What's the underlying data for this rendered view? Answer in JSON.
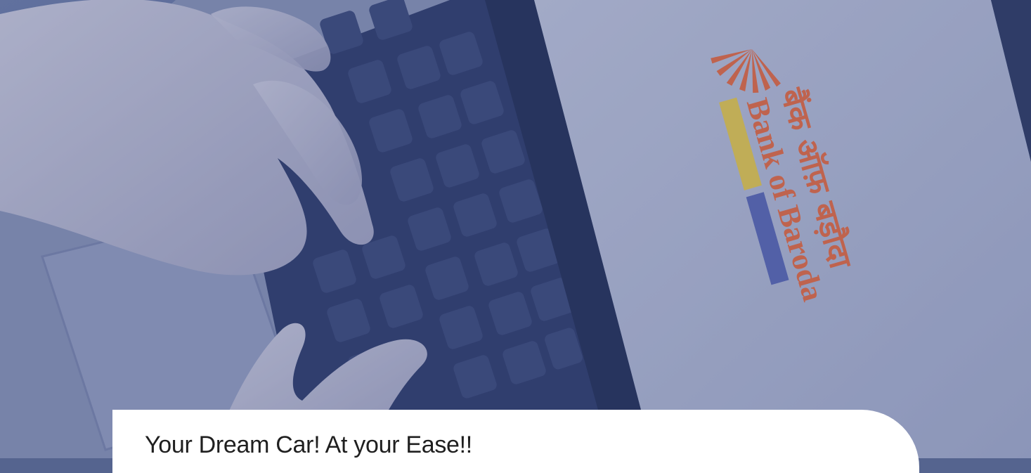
{
  "hero": {
    "logo_text_hindi": "बैंक ऑफ़ बड़ौदा",
    "logo_text_english": "Bank of Baroda",
    "colors": {
      "overlay": "#3c4e86",
      "brand_orange": "#f26b3a",
      "brand_yellow": "#f3d146"
    }
  },
  "banner": {
    "title": "Your Dream Car! At your Ease!!"
  }
}
